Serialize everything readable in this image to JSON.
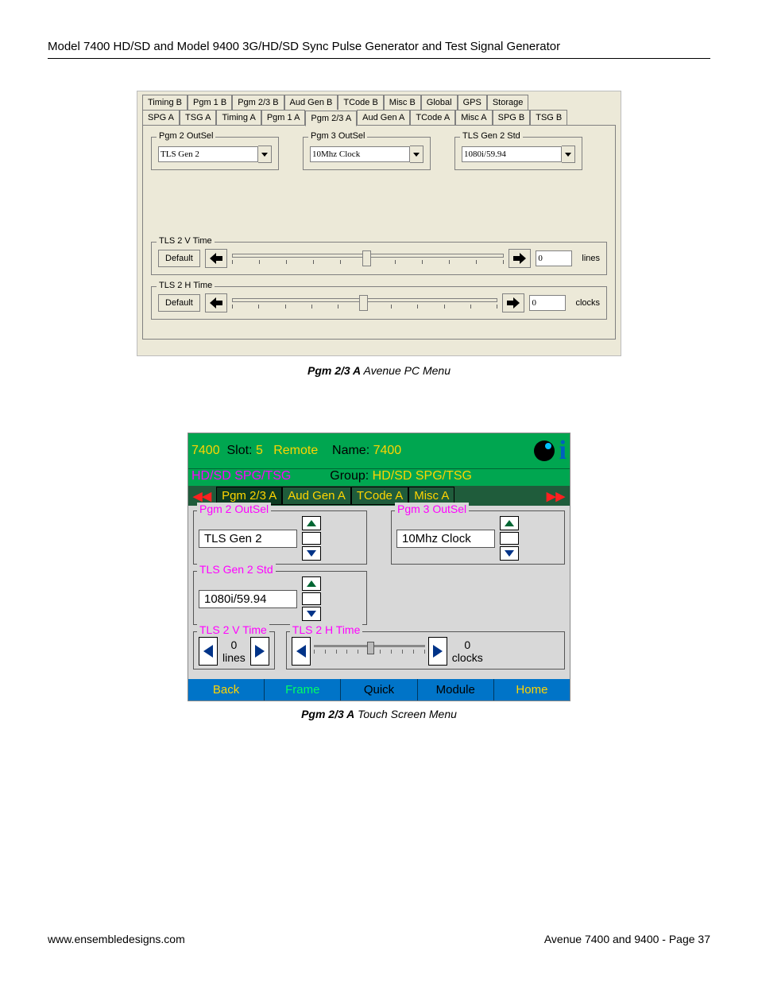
{
  "header": "Model 7400 HD/SD and Model 9400 3G/HD/SD Sync Pulse Generator and Test Signal Generator",
  "pcmenu": {
    "tabs_row1": [
      "Timing B",
      "Pgm 1 B",
      "Pgm 2/3 B",
      "Aud Gen B",
      "TCode B",
      "Misc B",
      "Global",
      "GPS",
      "Storage"
    ],
    "tabs_row2": [
      "SPG A",
      "TSG A",
      "Timing A",
      "Pgm 1 A",
      "Pgm 2/3 A",
      "Aud Gen A",
      "TCode A",
      "Misc A",
      "SPG B",
      "TSG B"
    ],
    "selected_tab": "Pgm 2/3 A",
    "groups": {
      "pgm2outsel": {
        "label": "Pgm 2 OutSel",
        "value": "TLS Gen 2"
      },
      "pgm3outsel": {
        "label": "Pgm 3 OutSel",
        "value": "10Mhz Clock"
      },
      "tlsgen2std": {
        "label": "TLS Gen 2 Std",
        "value": "1080i/59.94"
      }
    },
    "sliders": {
      "vtime": {
        "label": "TLS 2 V Time",
        "default_btn": "Default",
        "value": "0",
        "unit": "lines"
      },
      "htime": {
        "label": "TLS 2 H Time",
        "default_btn": "Default",
        "value": "0",
        "unit": "clocks"
      }
    }
  },
  "pc_caption": {
    "bold": "Pgm 2/3 A",
    "rest": " Avenue PC Menu"
  },
  "touch": {
    "top": {
      "id": "7400",
      "slot_label": "Slot:",
      "slot": "5",
      "remote": "Remote",
      "name_label": "Name:",
      "name": "7400"
    },
    "sub": {
      "line1": "HD/SD SPG/TSG",
      "group_label": "Group:",
      "group": "HD/SD SPG/TSG"
    },
    "tabs": [
      "Pgm 2/3 A",
      "Aud Gen A",
      "TCode A",
      "Misc A"
    ],
    "selected_tab": "Pgm 2/3 A",
    "groups": {
      "pgm2outsel": {
        "label": "Pgm 2 OutSel",
        "value": "TLS Gen 2"
      },
      "pgm3outsel": {
        "label": "Pgm 3 OutSel",
        "value": "10Mhz Clock"
      },
      "tlsgen2std": {
        "label": "TLS Gen 2 Std",
        "value": "1080i/59.94"
      },
      "tls2v": {
        "label": "TLS 2 V Time",
        "value": "0",
        "unit": "lines"
      },
      "tls2h": {
        "label": "TLS 2 H Time",
        "value": "0",
        "unit": "clocks"
      }
    },
    "footer": [
      "Back",
      "Frame",
      "Quick",
      "Module",
      "Home"
    ]
  },
  "touch_caption": {
    "bold": "Pgm 2/3 A",
    "rest": " Touch Screen Menu"
  },
  "footer": {
    "left": "www.ensembledesigns.com",
    "right": "Avenue 7400 and 9400 - Page 37"
  }
}
